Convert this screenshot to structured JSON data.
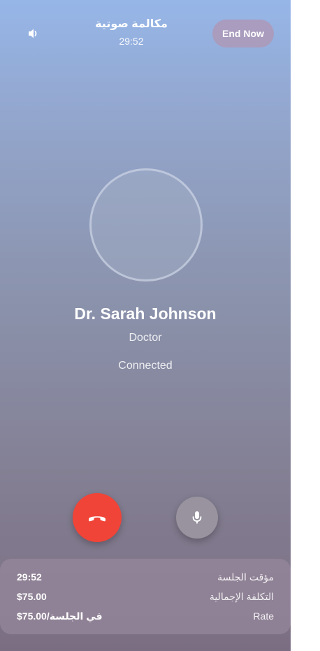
{
  "header": {
    "speaker_icon": "speaker-icon",
    "title": "مكالمة صوتية",
    "timer": "29:52",
    "end_now_label": "End Now"
  },
  "contact": {
    "name": "Dr. Sarah Johnson",
    "role": "Doctor",
    "status": "Connected"
  },
  "controls": {
    "hangup_icon": "phone-hangup-icon",
    "mic_icon": "microphone-icon"
  },
  "session": {
    "rows": [
      {
        "label": "مؤقت الجلسة",
        "value": "29:52"
      },
      {
        "label": "التكلفة الإجمالية",
        "value": "$75.00"
      },
      {
        "label": "Rate",
        "value": "$75.00/في الجلسة"
      }
    ]
  },
  "colors": {
    "hangup": "#f04438",
    "mic_button": "#98939e",
    "end_now_button": "#af96b4"
  }
}
